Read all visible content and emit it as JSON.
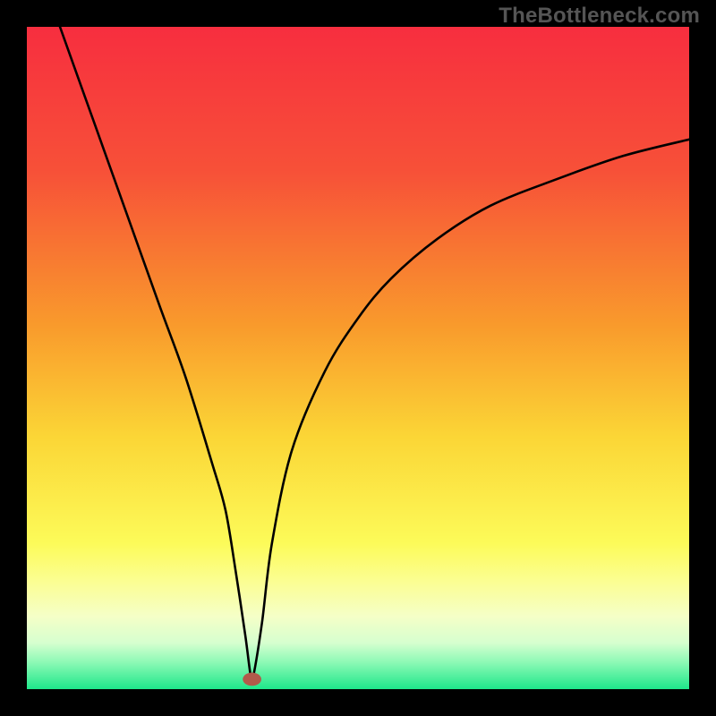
{
  "watermark": "TheBottleneck.com",
  "chart_data": {
    "type": "line",
    "title": "",
    "xlabel": "",
    "ylabel": "",
    "xlim": [
      0,
      100
    ],
    "ylim": [
      0,
      100
    ],
    "gradient_stops": [
      {
        "offset": 0,
        "color": "#f72e3f"
      },
      {
        "offset": 22,
        "color": "#f75138"
      },
      {
        "offset": 45,
        "color": "#f99a2c"
      },
      {
        "offset": 62,
        "color": "#fbd636"
      },
      {
        "offset": 78,
        "color": "#fcfb59"
      },
      {
        "offset": 84,
        "color": "#fbfe95"
      },
      {
        "offset": 89,
        "color": "#f5ffc7"
      },
      {
        "offset": 93,
        "color": "#d6ffcf"
      },
      {
        "offset": 96,
        "color": "#8bf9b5"
      },
      {
        "offset": 100,
        "color": "#1ee78a"
      }
    ],
    "series": [
      {
        "name": "bottleneck-curve",
        "x": [
          5,
          10,
          15,
          20,
          24,
          28,
          30,
          31.5,
          33,
          33.8,
          34.2,
          35.5,
          37,
          40,
          45,
          50,
          55,
          62,
          70,
          80,
          90,
          100
        ],
        "y": [
          100,
          86,
          72,
          58,
          47,
          34,
          27,
          18,
          8,
          2,
          2,
          10,
          22,
          36,
          48,
          56,
          62,
          68,
          73,
          77,
          80.5,
          83
        ]
      }
    ],
    "marker": {
      "x": 34,
      "y": 1.5,
      "rx": 1.4,
      "ry": 1.0,
      "color": "#b25a4a"
    },
    "legend": null
  }
}
